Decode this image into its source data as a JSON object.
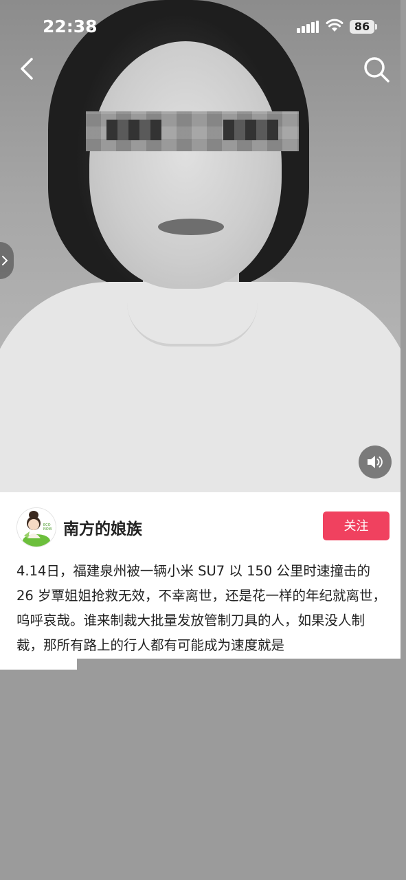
{
  "status_bar": {
    "time": "22:38",
    "battery": "86",
    "icons": [
      "signal-icon",
      "wifi-icon",
      "battery-icon"
    ]
  },
  "nav": {
    "back_icon": "chevron-left-icon",
    "search_icon": "search-icon"
  },
  "media": {
    "side_handle_icon": "chevron-right-icon",
    "sound_icon": "speaker-icon"
  },
  "author": {
    "name": "南方的娘族",
    "follow_label": "关注"
  },
  "post": {
    "text": "4.14日，福建泉州被一辆小米 SU7 以 150 公里时速撞击的 26 岁覃姐姐抢救无效，不幸离世，还是花一样的年纪就离世，呜呼哀哉。谁来制裁大批量发放管制刀具的人，如果没人制裁，那所有路上的行人都有可能成为速度就是"
  },
  "colors": {
    "accent": "#f0415f",
    "overlay": "#9b9b9b"
  }
}
